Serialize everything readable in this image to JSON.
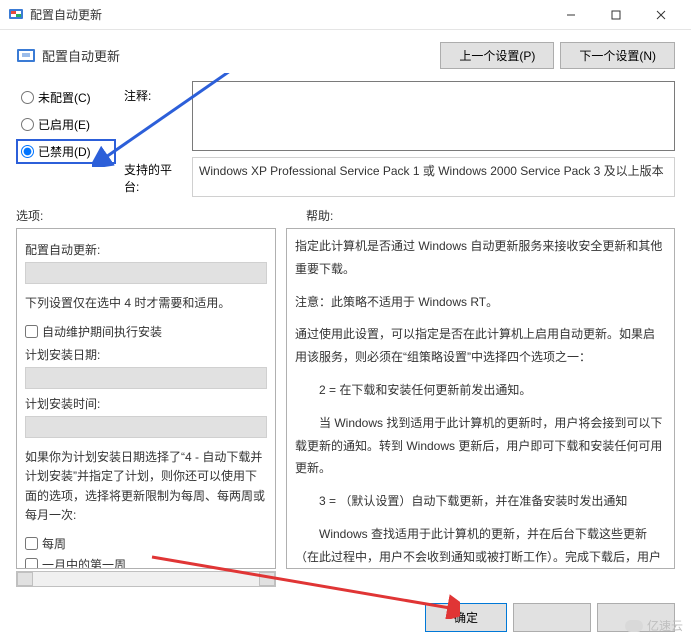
{
  "window": {
    "title": "配置自动更新",
    "header_title": "配置自动更新"
  },
  "nav": {
    "prev": "上一个设置(P)",
    "next": "下一个设置(N)"
  },
  "radio": {
    "not_configured": "未配置(C)",
    "enabled": "已启用(E)",
    "disabled": "已禁用(D)"
  },
  "labels": {
    "comment": "注释:",
    "platform": "支持的平台:",
    "options": "选项:",
    "help": "帮助:"
  },
  "platform_text": "Windows XP Professional Service Pack 1 或 Windows 2000 Service Pack 3 及以上版本",
  "options_panel": {
    "configure_label": "配置自动更新:",
    "note1": "下列设置仅在选中 4 时才需要和适用。",
    "cb_maint": "自动维护期间执行安装",
    "install_date_label": "计划安装日期:",
    "install_time_label": "计划安装时间:",
    "note2": "如果你为计划安装日期选择了“4 - 自动下载并计划安装”并指定了计划，则你还可以使用下面的选项，选择将更新限制为每周、每两周或每月一次:",
    "cb_weekly": "每周",
    "cb_first_week": "一月中的第一周"
  },
  "help_panel": {
    "p1": "指定此计算机是否通过 Windows 自动更新服务来接收安全更新和其他重要下载。",
    "p2": "注意：此策略不适用于 Windows RT。",
    "p3": "通过使用此设置，可以指定是否在此计算机上启用自动更新。如果启用该服务，则必须在“组策略设置”中选择四个选项之一：",
    "p4": "　　2 = 在下载和安装任何更新前发出通知。",
    "p5": "　　当 Windows 找到适用于此计算机的更新时，用户将会接到可以下载更新的通知。转到 Windows 更新后，用户即可下载和安装任何可用更新。",
    "p6": "　　3 = （默认设置）自动下载更新，并在准备安装时发出通知",
    "p7": "　　Windows 查找适用于此计算机的更新，并在后台下载这些更新（在此过程中，用户不会收到通知或被打断工作）。完成下载后，用户将收到可以安装更新的通知。转到 Windows 更新后，用户即可安装更新。"
  },
  "footer": {
    "ok": "确定"
  },
  "watermark": "亿速云"
}
